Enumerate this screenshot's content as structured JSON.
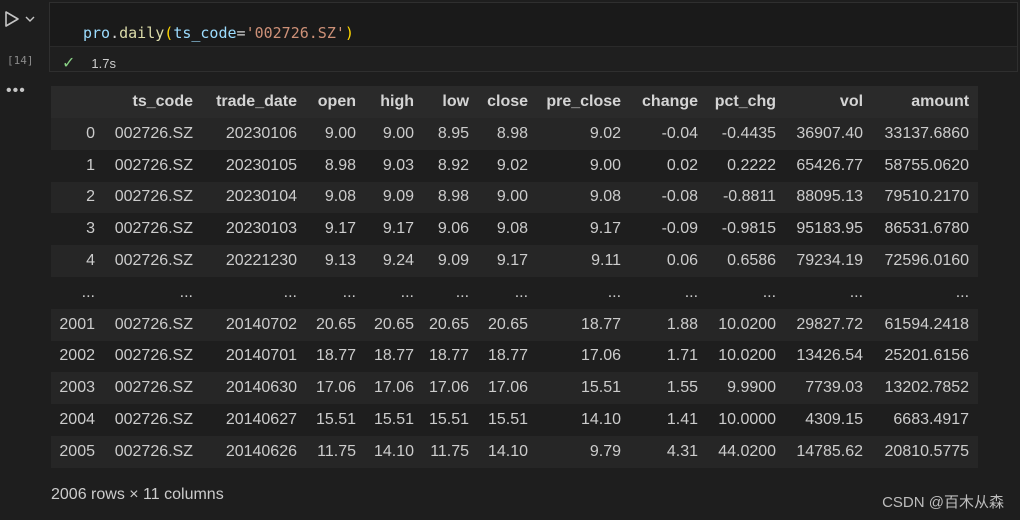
{
  "cell": {
    "execution_count": "[14]",
    "code": {
      "object": "pro",
      "dot": ".",
      "method": "daily",
      "open_paren": "(",
      "arg_name": "ts_code",
      "equals": "=",
      "arg_value": "'002726.SZ'",
      "close_paren": ")"
    },
    "status": {
      "icon": "check-icon",
      "duration": "1.7s"
    }
  },
  "dataframe": {
    "columns": [
      "ts_code",
      "trade_date",
      "open",
      "high",
      "low",
      "close",
      "pre_close",
      "change",
      "pct_chg",
      "vol",
      "amount"
    ],
    "rows": [
      {
        "index": "0",
        "cells": [
          "002726.SZ",
          "20230106",
          "9.00",
          "9.00",
          "8.95",
          "8.98",
          "9.02",
          "-0.04",
          "-0.4435",
          "36907.40",
          "33137.6860"
        ]
      },
      {
        "index": "1",
        "cells": [
          "002726.SZ",
          "20230105",
          "8.98",
          "9.03",
          "8.92",
          "9.02",
          "9.00",
          "0.02",
          "0.2222",
          "65426.77",
          "58755.0620"
        ]
      },
      {
        "index": "2",
        "cells": [
          "002726.SZ",
          "20230104",
          "9.08",
          "9.09",
          "8.98",
          "9.00",
          "9.08",
          "-0.08",
          "-0.8811",
          "88095.13",
          "79510.2170"
        ]
      },
      {
        "index": "3",
        "cells": [
          "002726.SZ",
          "20230103",
          "9.17",
          "9.17",
          "9.06",
          "9.08",
          "9.17",
          "-0.09",
          "-0.9815",
          "95183.95",
          "86531.6780"
        ]
      },
      {
        "index": "4",
        "cells": [
          "002726.SZ",
          "20221230",
          "9.13",
          "9.24",
          "9.09",
          "9.17",
          "9.11",
          "0.06",
          "0.6586",
          "79234.19",
          "72596.0160"
        ]
      },
      {
        "index": "...",
        "cells": [
          "...",
          "...",
          "...",
          "...",
          "...",
          "...",
          "...",
          "...",
          "...",
          "...",
          "..."
        ]
      },
      {
        "index": "2001",
        "cells": [
          "002726.SZ",
          "20140702",
          "20.65",
          "20.65",
          "20.65",
          "20.65",
          "18.77",
          "1.88",
          "10.0200",
          "29827.72",
          "61594.2418"
        ]
      },
      {
        "index": "2002",
        "cells": [
          "002726.SZ",
          "20140701",
          "18.77",
          "18.77",
          "18.77",
          "18.77",
          "17.06",
          "1.71",
          "10.0200",
          "13426.54",
          "25201.6156"
        ]
      },
      {
        "index": "2003",
        "cells": [
          "002726.SZ",
          "20140630",
          "17.06",
          "17.06",
          "17.06",
          "17.06",
          "15.51",
          "1.55",
          "9.9900",
          "7739.03",
          "13202.7852"
        ]
      },
      {
        "index": "2004",
        "cells": [
          "002726.SZ",
          "20140627",
          "15.51",
          "15.51",
          "15.51",
          "15.51",
          "14.10",
          "1.41",
          "10.0000",
          "4309.15",
          "6683.4917"
        ]
      },
      {
        "index": "2005",
        "cells": [
          "002726.SZ",
          "20140626",
          "11.75",
          "14.10",
          "11.75",
          "14.10",
          "9.79",
          "4.31",
          "44.0200",
          "14785.62",
          "20810.5775"
        ]
      }
    ],
    "shape_text": "2006 rows × 11 columns"
  },
  "watermark": "CSDN @百木从森",
  "colors": {
    "background": "#1e1e1e",
    "success": "#89d185",
    "string": "#ce9178",
    "identifier": "#9cdcfe",
    "function": "#dcdcaa",
    "bracket": "#ffd700"
  }
}
